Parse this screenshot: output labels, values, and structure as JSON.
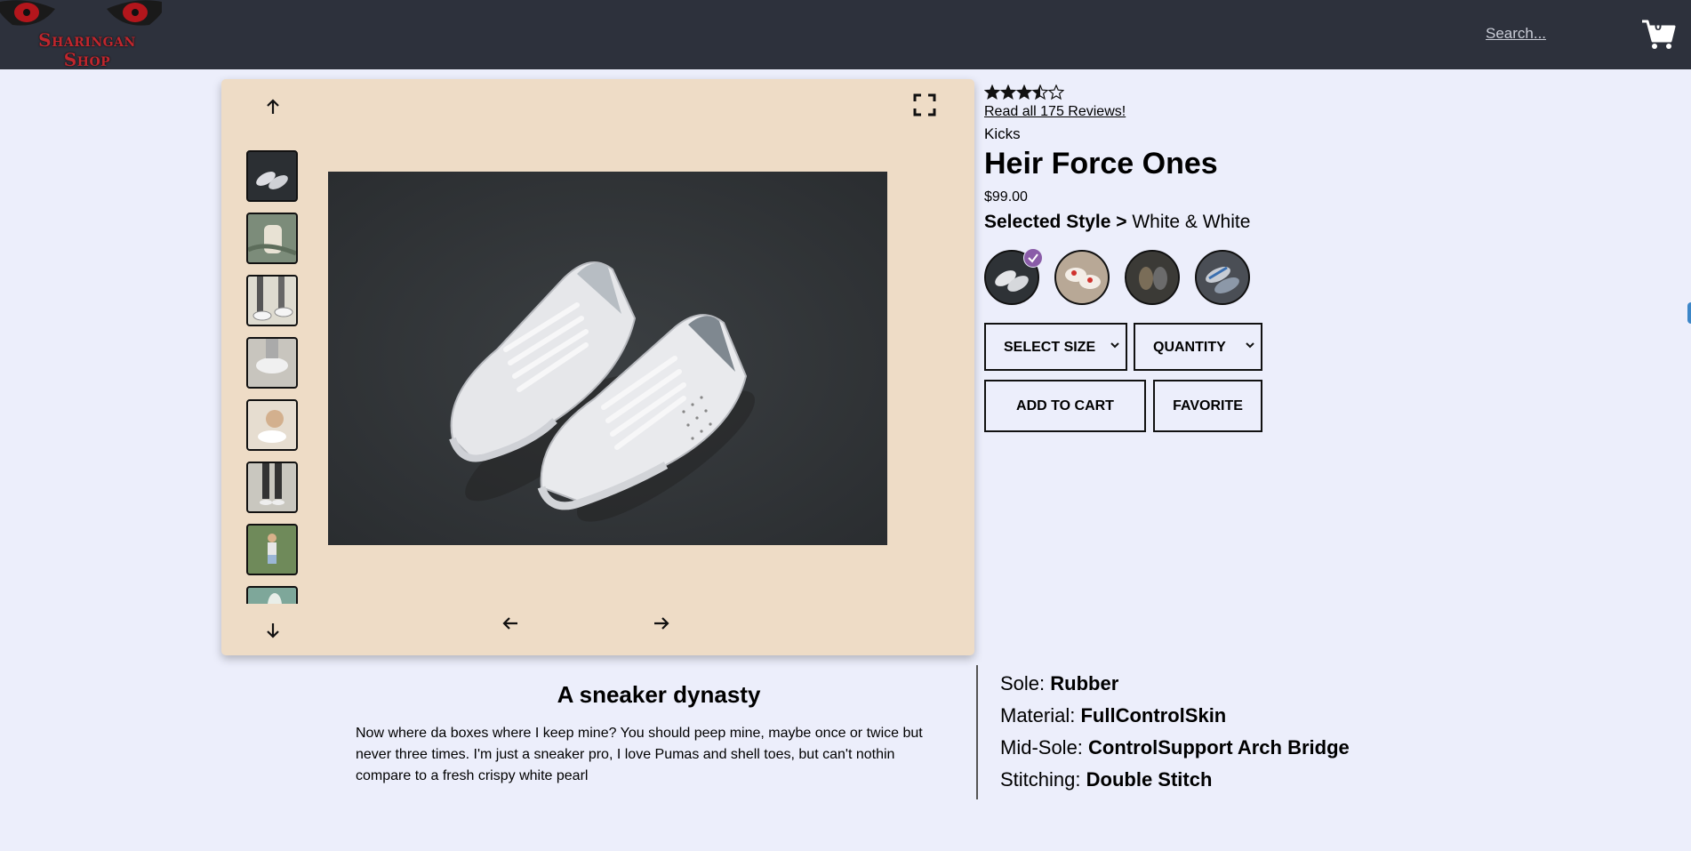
{
  "header": {
    "logo_line1": "Sharingan",
    "logo_line2": "Shop",
    "search_placeholder": "Search...",
    "cart_count": "0",
    "cart_icon": "cart-icon"
  },
  "gallery": {
    "up_icon": "arrow-up-icon",
    "down_icon": "arrow-down-icon",
    "left_icon": "arrow-left-icon",
    "right_icon": "arrow-right-icon",
    "expand_icon": "expand-icon",
    "thumbnail_count_visible": 8,
    "selected_thumbnail": 1
  },
  "product": {
    "rating": 3.5,
    "rating_max": 5,
    "reviews_link": "Read all 175 Reviews!",
    "category": "Kicks",
    "name": "Heir Force Ones",
    "price": "$99.00",
    "style_label": "Selected Style >",
    "style_value": "White & White",
    "styles_count": 4,
    "selected_style": 1,
    "size_select": "SELECT SIZE",
    "quantity_select": "QUANTITY",
    "add_to_cart": "ADD TO CART",
    "favorite": "FAVORITE"
  },
  "description": {
    "title": "A sneaker dynasty",
    "body": "Now where da boxes where I keep mine? You should peep mine, maybe once or twice but never three times. I'm just a sneaker pro, I love Pumas and shell toes, but can't nothin compare to a fresh crispy white pearl"
  },
  "features": [
    {
      "key": "Sole:",
      "value": "Rubber"
    },
    {
      "key": "Material:",
      "value": "FullControlSkin"
    },
    {
      "key": "Mid-Sole:",
      "value": "ControlSupport Arch Bridge"
    },
    {
      "key": "Stitching:",
      "value": "Double Stitch"
    }
  ],
  "colors": {
    "header_bg": "#2d313c",
    "page_bg": "#eceefb",
    "gallery_bg": "#eedcc6",
    "logo_red": "#c0262d",
    "check_badge": "#8a5ca8"
  }
}
